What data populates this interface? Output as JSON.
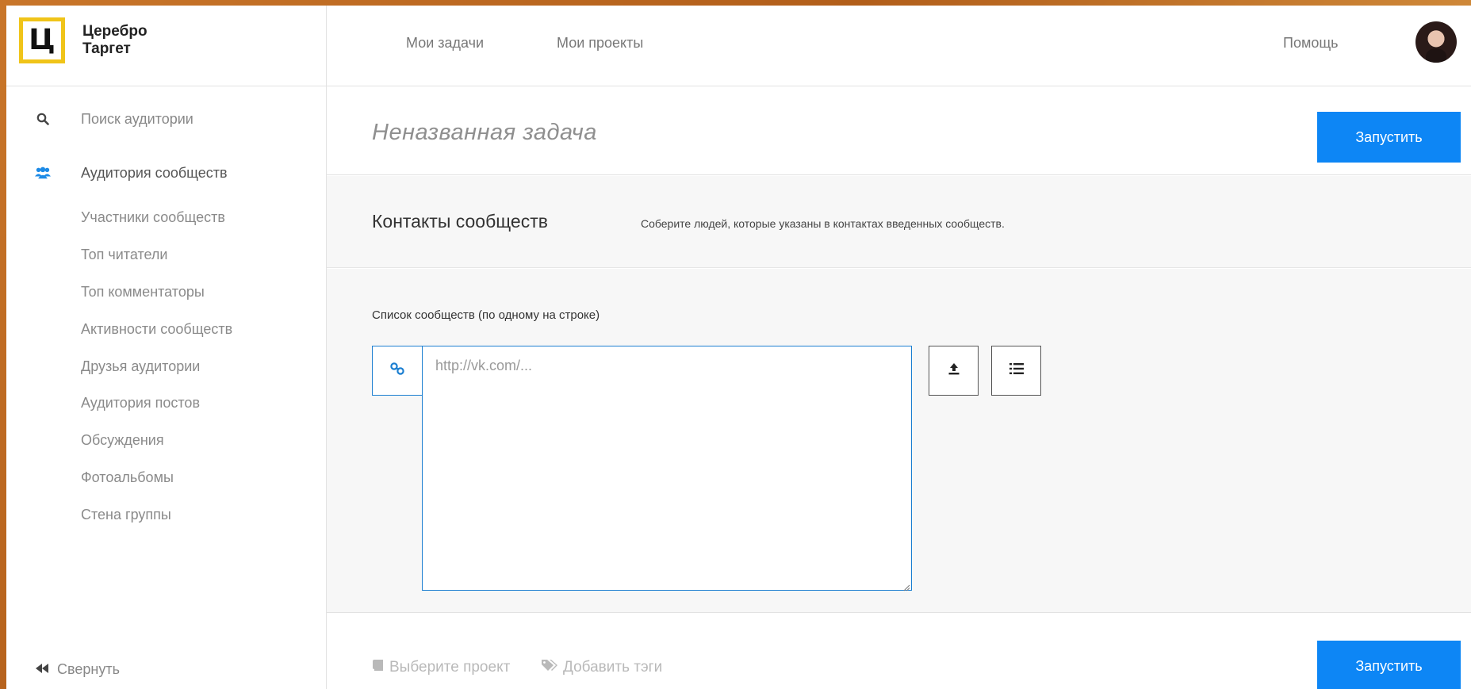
{
  "brand": {
    "logo_letter": "Ц",
    "name_line1": "Церебро",
    "name_line2": "Таргет"
  },
  "topnav": {
    "items": [
      {
        "label": "Мои задачи"
      },
      {
        "label": "Мои проекты"
      }
    ],
    "help": "Помощь"
  },
  "sidebar": {
    "search": "Поиск аудитории",
    "group": "Аудитория сообществ",
    "items": [
      {
        "label": "Участники сообществ"
      },
      {
        "label": "Топ читатели"
      },
      {
        "label": "Топ комментаторы"
      },
      {
        "label": "Активности сообществ"
      },
      {
        "label": "Друзья аудитории"
      },
      {
        "label": "Аудитория постов"
      },
      {
        "label": "Обсуждения"
      },
      {
        "label": "Фотоальбомы"
      },
      {
        "label": "Стена группы"
      }
    ],
    "collapse": "Свернуть"
  },
  "task": {
    "title": "Неназванная задача",
    "run_label": "Запустить"
  },
  "section": {
    "title": "Контакты сообществ",
    "description": "Соберите людей, которые указаны в контактах введенных сообществ."
  },
  "form": {
    "field_label": "Список сообществ (по одному на строке)",
    "placeholder": "http://vk.com/...",
    "value": ""
  },
  "footer": {
    "project": "Выберите проект",
    "tags": "Добавить тэги",
    "run_label": "Запустить"
  },
  "colors": {
    "accent": "#0d86f5",
    "logo_border": "#f0c419",
    "icon_blue": "#1c7fd1"
  }
}
